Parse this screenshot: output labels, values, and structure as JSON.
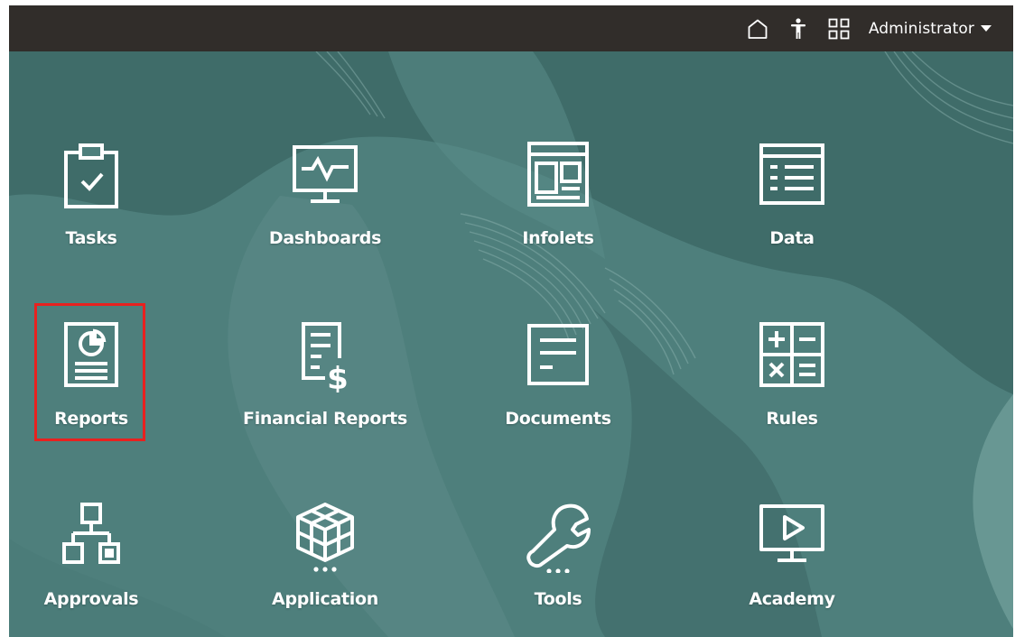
{
  "header": {
    "user_name": "Administrator",
    "icons": [
      "home-icon",
      "accessibility-icon",
      "navigator-icon"
    ]
  },
  "colors": {
    "header_bg": "#312d2a",
    "background": "#4e7f7c",
    "highlight": "#e8211f"
  },
  "tiles": [
    {
      "label": "Tasks",
      "icon": "clipboard-check-icon"
    },
    {
      "label": "Dashboards",
      "icon": "monitor-chart-icon"
    },
    {
      "label": "Infolets",
      "icon": "infolet-layout-icon"
    },
    {
      "label": "Data",
      "icon": "data-grid-icon"
    },
    {
      "label": "Reports",
      "icon": "report-pie-icon"
    },
    {
      "label": "Financial Reports",
      "icon": "financial-report-icon"
    },
    {
      "label": "Documents",
      "icon": "document-icon"
    },
    {
      "label": "Rules",
      "icon": "calculator-icon"
    },
    {
      "label": "Approvals",
      "icon": "hierarchy-icon"
    },
    {
      "label": "Application",
      "icon": "cube-icon"
    },
    {
      "label": "Tools",
      "icon": "wrench-icon"
    },
    {
      "label": "Academy",
      "icon": "play-monitor-icon"
    }
  ]
}
